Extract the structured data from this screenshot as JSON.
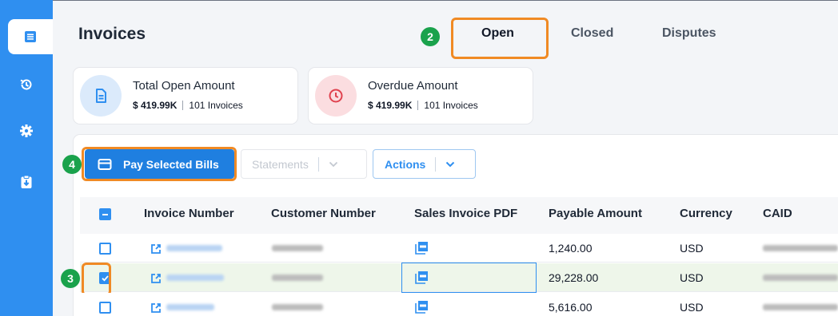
{
  "sidebar": {
    "items": [
      {
        "icon": "invoice-list-icon",
        "active": true
      },
      {
        "icon": "history-icon",
        "active": false
      },
      {
        "icon": "gear-icon",
        "active": false
      },
      {
        "icon": "clipboard-download-icon",
        "active": false
      }
    ]
  },
  "header": {
    "title": "Invoices",
    "tabs": [
      "Open",
      "Closed",
      "Disputes"
    ],
    "active_tab": "Open"
  },
  "steps": {
    "tab_open": "2",
    "row_checkbox": "3",
    "pay_button": "4"
  },
  "summary": {
    "total_open": {
      "label": "Total Open Amount",
      "amount": "$ 419.99K",
      "count": "101 Invoices",
      "icon": "document-icon"
    },
    "overdue": {
      "label": "Overdue Amount",
      "amount": "$ 419.99K",
      "count": "101 Invoices",
      "icon": "clock-icon"
    }
  },
  "toolbar": {
    "pay_selected": "Pay Selected Bills",
    "statements": "Statements",
    "actions": "Actions"
  },
  "table": {
    "columns": [
      "Invoice Number",
      "Customer Number",
      "Sales Invoice PDF",
      "Payable Amount",
      "Currency",
      "CAID"
    ],
    "rows": [
      {
        "payable_amount": "1,240.00",
        "currency": "USD",
        "selected": false
      },
      {
        "payable_amount": "29,228.00",
        "currency": "USD",
        "selected": true
      },
      {
        "payable_amount": "5,616.00",
        "currency": "USD",
        "selected": false
      }
    ]
  },
  "colors": {
    "accent": "#2f8ff0",
    "highlight": "#f08a24",
    "step_badge": "#1aa24c",
    "selected_row": "#eef6ea"
  }
}
